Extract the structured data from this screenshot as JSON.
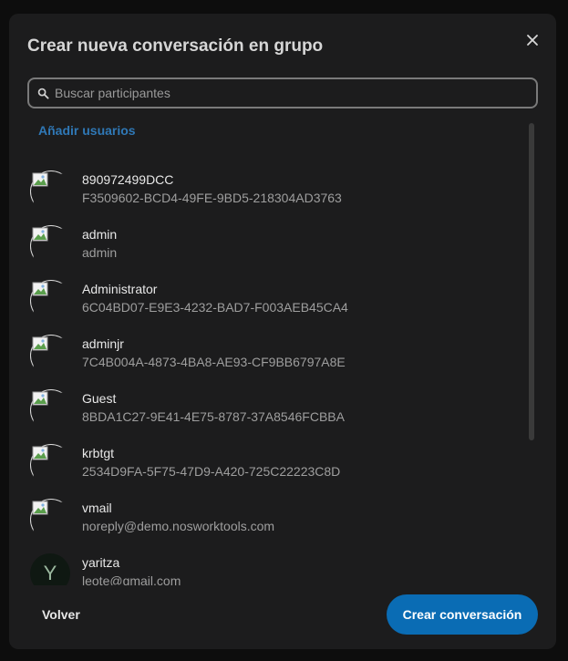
{
  "dialog": {
    "title": "Crear nueva conversación en grupo",
    "close_icon": "close-icon"
  },
  "search": {
    "placeholder": "Buscar participantes",
    "value": "",
    "icon": "search-icon"
  },
  "add_users_label": "Añadir usuarios",
  "users": [
    {
      "name": "890972499DCC",
      "subtitle": "F3509602-BCD4-49FE-9BD5-218304AD3763",
      "avatar": "broken-image"
    },
    {
      "name": "admin",
      "subtitle": "admin",
      "avatar": "broken-image"
    },
    {
      "name": "Administrator",
      "subtitle": "6C04BD07-E9E3-4232-BAD7-F003AEB45CA4",
      "avatar": "broken-image"
    },
    {
      "name": "adminjr",
      "subtitle": "7C4B004A-4873-4BA8-AE93-CF9BB6797A8E",
      "avatar": "broken-image"
    },
    {
      "name": "Guest",
      "subtitle": "8BDA1C27-9E41-4E75-8787-37A8546FCBBA",
      "avatar": "broken-image"
    },
    {
      "name": "krbtgt",
      "subtitle": "2534D9FA-5F75-47D9-A420-725C22223C8D",
      "avatar": "broken-image"
    },
    {
      "name": "vmail",
      "subtitle": "noreply@demo.nosworktools.com",
      "avatar": "broken-image"
    },
    {
      "name": "yaritza",
      "subtitle": "leote@gmail.com",
      "avatar": "letter",
      "initial": "Y"
    }
  ],
  "footer": {
    "back_label": "Volver",
    "create_label": "Crear conversación"
  },
  "colors": {
    "accent": "#0a6cb4",
    "link": "#2f78b6",
    "background": "#1c1c1d"
  }
}
